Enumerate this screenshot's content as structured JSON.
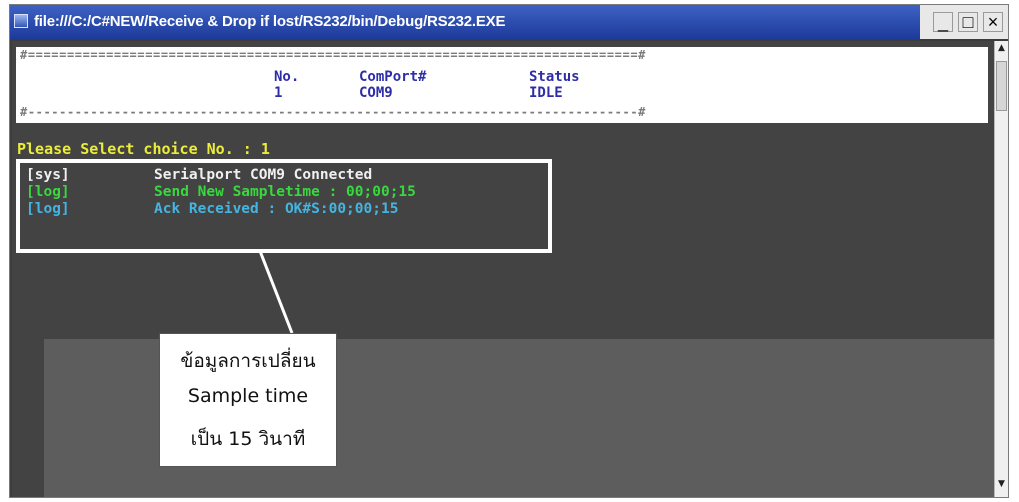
{
  "window": {
    "title": "file:///C:/C#NEW/Receive & Drop if lost/RS232/bin/Debug/RS232.EXE",
    "icon": "console-app-icon",
    "controls": {
      "minimize": "_",
      "maximize": "□",
      "close": "×"
    }
  },
  "console": {
    "rule_top": "#==============================================================================#",
    "rule_bottom": "#------------------------------------------------------------------------------#",
    "table": {
      "headers": [
        "No.",
        "ComPort#",
        "Status"
      ],
      "rows": [
        [
          "1",
          "COM9",
          "IDLE"
        ]
      ]
    },
    "prompt": "Please Select choice No. : 1",
    "log": [
      {
        "tag": "[sys]",
        "message": "Serialport COM9 Connected"
      },
      {
        "tag": "[log]",
        "message": "Send New Sampletime : 00;00;15"
      },
      {
        "tag": "[log]",
        "message": "Ack Received : OK#S:00;00;15"
      }
    ]
  },
  "callout": {
    "lines": [
      "ข้อมูลการเปลี่ยน",
      "Sample time",
      "เป็น 15 วินาที"
    ]
  },
  "colors": {
    "titlebar": "#2447ae",
    "console_bg": "#434343",
    "header_text": "#2d2da8",
    "prompt": "#ecec3a",
    "log_sys": "#f0f0f0",
    "log_send": "#39d83f",
    "log_ack": "#45b4e0"
  }
}
